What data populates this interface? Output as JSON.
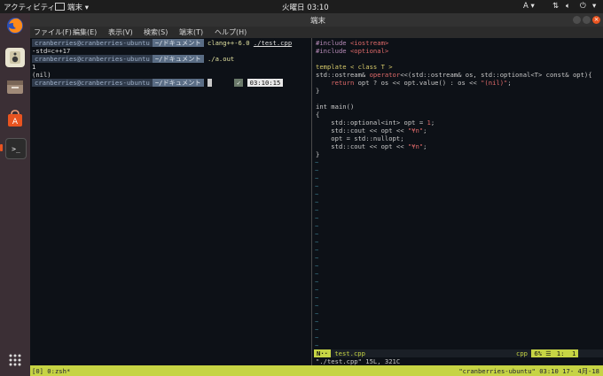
{
  "topbar": {
    "activities": "アクティビティ",
    "app_name": "端末",
    "clock": "火曜日 03:10",
    "input_method": "A"
  },
  "window": {
    "title": "端末"
  },
  "menu": [
    "ファイル(F)",
    "編集(E)",
    "表示(V)",
    "検索(S)",
    "端末(T)",
    "ヘルプ(H)"
  ],
  "left_pane": {
    "prompt1": {
      "user": "cranberries@cranberries-ubuntu",
      "dir": "~/ドキュメント",
      "cmd": "clang++-6.0",
      "arg": "./test.cpp"
    },
    "prompt1_cont": "-std=c++17",
    "prompt2": {
      "user": "cranberries@cranberries-ubuntu",
      "dir": "~/ドキュメント",
      "cmd": "./a.out"
    },
    "output": [
      "1",
      "(nil)"
    ],
    "prompt3": {
      "user": "cranberries@cranberries-ubuntu",
      "dir": "~/ドキュメント",
      "check": "✓",
      "time": "03:10:15"
    }
  },
  "editor": {
    "lines": [
      "#include <iostream>",
      "#include <optional>",
      "",
      "template < class T >",
      "std::ostream& operator<<(std::ostream& os, std::optional<T> const& opt){",
      "    return opt ? os << opt.value() : os << \"(nil)\";",
      "}",
      "",
      "int main()",
      "{",
      "    std::optional<int> opt = 1;",
      "    std::cout << opt << \"¥n\";",
      "    opt = std::nullopt;",
      "    std::cout << opt << \"¥n\";",
      "}"
    ],
    "mode": "N··",
    "filename": "test.cpp",
    "filetype": "cpp",
    "percent": "6%",
    "position": "1:  1",
    "message": "\"./test.cpp\" 15L, 321C"
  },
  "tmux": {
    "left": "[0] 0:zsh*",
    "right": "\"cranberries-ubuntu\" 03:10 17- 4月-18"
  },
  "colors": {
    "accent": "#e95420",
    "status": "#c6d444",
    "dir_segment": "#5a6d85"
  }
}
